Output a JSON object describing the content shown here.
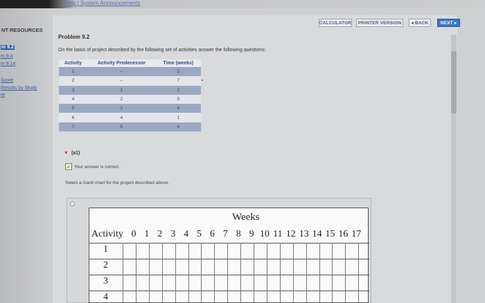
{
  "header": {
    "top_links": "Help | System Announcements",
    "buttons": {
      "calculator": "CALCULATOR",
      "printer": "PRINTER VERSION",
      "back": "◂ BACK",
      "next": "NEXT ▸"
    }
  },
  "sidebar": {
    "title": "NT RESOURCES",
    "items": [
      {
        "label": "m 9.2",
        "active": true
      },
      {
        "label": "m 9.4",
        "active": false
      },
      {
        "label": "m 9.14",
        "active": false
      },
      {
        "label": "Score",
        "active": false
      },
      {
        "label": "Results by Study",
        "active": false
      },
      {
        "label": "re",
        "active": false
      }
    ]
  },
  "problem": {
    "title": "Problem 9.2",
    "text": "On the basis of project described by the following set of activities answer the following questions:",
    "table": {
      "headers": [
        "Activity",
        "Activity Predecessor",
        "Time (weeks)"
      ],
      "rows": [
        [
          "1",
          "–",
          "3"
        ],
        [
          "2",
          "–",
          "7"
        ],
        [
          "3",
          "1",
          "2"
        ],
        [
          "4",
          "2",
          "5"
        ],
        [
          "5",
          "2",
          "6"
        ],
        [
          "6",
          "4",
          "1"
        ],
        [
          "7",
          "5",
          "4"
        ]
      ]
    }
  },
  "part": {
    "label": "(a1)",
    "status": "Your answer is correct.",
    "question": "Select a Gantt chart for the project described above."
  },
  "gantt": {
    "weeks_label": "Weeks",
    "activity_label": "Activity",
    "weeks": [
      "0",
      "1",
      "2",
      "3",
      "4",
      "5",
      "6",
      "7",
      "8",
      "9",
      "10",
      "11",
      "12",
      "13",
      "14",
      "15",
      "16",
      "17"
    ],
    "rows": [
      "1",
      "2",
      "3",
      "4"
    ]
  }
}
